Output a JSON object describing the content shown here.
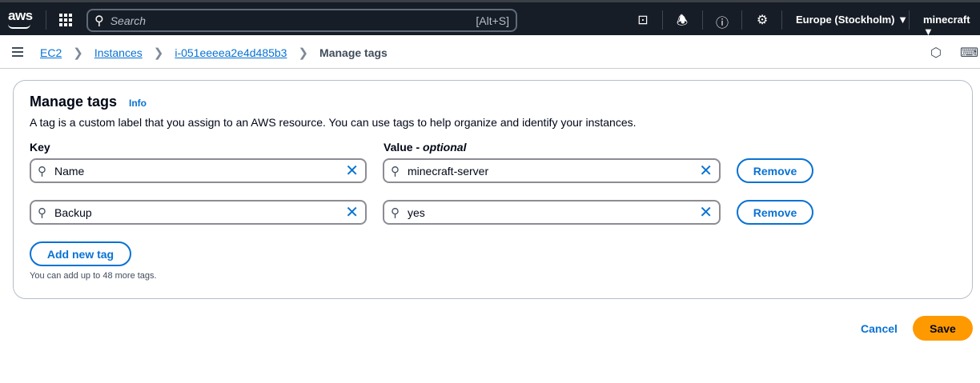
{
  "topnav": {
    "logo": "aws",
    "search_placeholder": "Search",
    "search_shortcut": "[Alt+S]",
    "region": "Europe (Stockholm) ▼",
    "account": "minecraft ▼"
  },
  "breadcrumb": {
    "items": [
      "EC2",
      "Instances",
      "i-051eeeea2e4d485b3"
    ],
    "current": "Manage tags"
  },
  "panel": {
    "title": "Manage tags",
    "info": "Info",
    "description": "A tag is a custom label that you assign to an AWS resource. You can use tags to help organize and identify your instances.",
    "key_label": "Key",
    "value_label": "Value - ",
    "value_optional": "optional",
    "tags": [
      {
        "key": "Name",
        "value": "minecraft-server"
      },
      {
        "key": "Backup",
        "value": "yes"
      }
    ],
    "remove_label": "Remove",
    "add_label": "Add new tag",
    "hint": "You can add up to 48 more tags."
  },
  "actions": {
    "cancel": "Cancel",
    "save": "Save"
  },
  "colors": {
    "accent": "#0972d3",
    "primary": "#ff9900",
    "topbar": "#161d26"
  }
}
